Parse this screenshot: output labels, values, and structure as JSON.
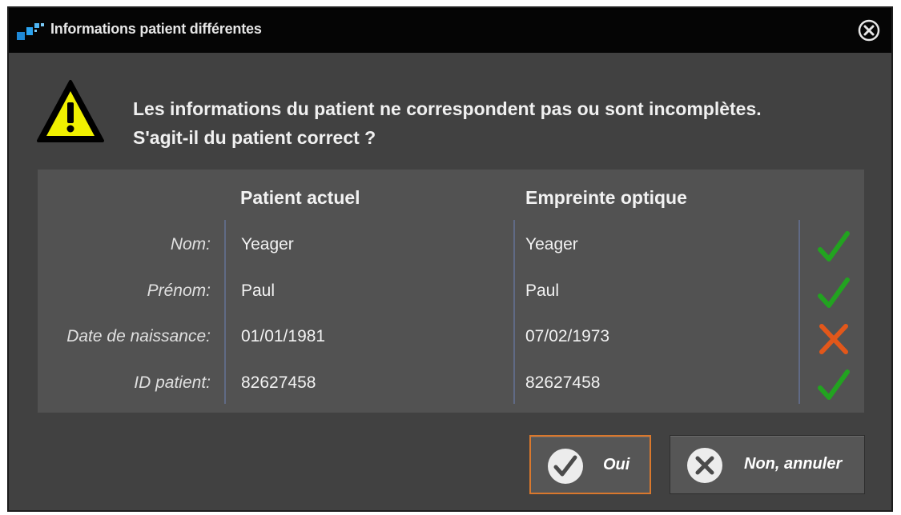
{
  "window": {
    "title": "Informations patient différentes"
  },
  "message": {
    "line1": "Les informations du patient ne correspondent pas ou sont incomplètes.",
    "line2": "S'agit-il du patient correct ?"
  },
  "table": {
    "headers": [
      "Patient actuel",
      "Empreinte optique"
    ],
    "rows": [
      {
        "label": "Nom:",
        "current": "Yeager",
        "optical": "Yeager",
        "status": "check-icon"
      },
      {
        "label": "Prénom:",
        "current": "Paul",
        "optical": "Paul",
        "status": "check-icon"
      },
      {
        "label": "Date de naissance:",
        "current": "01/01/1981",
        "optical": "07/02/1973",
        "status": "cross-icon"
      },
      {
        "label": "ID patient:",
        "current": "82627458",
        "optical": "82627458",
        "status": "check-icon"
      }
    ]
  },
  "buttons": {
    "yes": "Oui",
    "no": "Non, annuler"
  },
  "colors": {
    "match": "#22a320",
    "mismatch": "#e2571a",
    "primary_border": "#d9782d",
    "warning": "#f0f000"
  },
  "icons": {
    "app": "app-logo-icon",
    "close": "close-circle-icon",
    "warning": "warning-triangle-icon",
    "yes": "checkmark-circle-icon",
    "no": "x-circle-icon"
  }
}
